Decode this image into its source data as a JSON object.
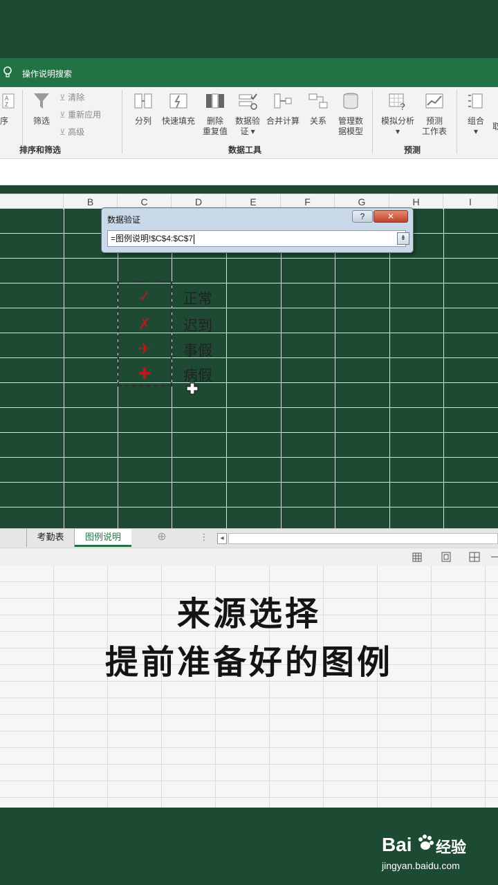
{
  "tellme": {
    "text": "操作说明搜索"
  },
  "ribbon": {
    "sort_label": "排序",
    "filter_label": "筛选",
    "clear_label": "清除",
    "reapply_label": "重新应用",
    "advanced_label": "高级",
    "sort_filter_group": "排序和筛选",
    "text_to_columns": "分列",
    "flash_fill": "快速填充",
    "remove_dup_1": "删除",
    "remove_dup_2": "重复值",
    "validation_1": "数据验",
    "validation_2": "证 ▾",
    "consolidate": "合并计算",
    "relationships": "关系",
    "manage_model_1": "管理数",
    "manage_model_2": "据模型",
    "data_tools_group": "数据工具",
    "whatif_1": "模拟分析",
    "whatif_2": "▾",
    "forecast_1": "预测",
    "forecast_2": "工作表",
    "forecast_group": "预测",
    "group_1": "组合",
    "group_2": "▾",
    "ungroup_partial": "取"
  },
  "columns": [
    "B",
    "C",
    "D",
    "E",
    "F",
    "G",
    "H",
    "I"
  ],
  "dialog": {
    "title": "数据验证",
    "help": "?",
    "close": "✕",
    "reference": "=图例说明!$C$4:$C$7",
    "collapse_icon": "⇟"
  },
  "legend": {
    "items": [
      {
        "symbol": "✓",
        "label": "正常"
      },
      {
        "symbol": "✗",
        "label": "迟到"
      },
      {
        "symbol": "✈",
        "label": "事假"
      },
      {
        "symbol": "✚",
        "label": "病假"
      }
    ]
  },
  "sheets": {
    "tab1": "考勤表",
    "tab2": "图例说明",
    "add": "⊕",
    "more": "⋮",
    "scroll_left": "◂"
  },
  "caption": {
    "line1": "来源选择",
    "line2": "提前准备好的图例"
  },
  "watermark": {
    "brand": "Bai",
    "brand2": "经验",
    "url": "jingyan.baidu.com"
  },
  "colors": {
    "excel_green": "#217346",
    "band_green": "#1d4a32",
    "symbol_red": "#b01c1c"
  }
}
